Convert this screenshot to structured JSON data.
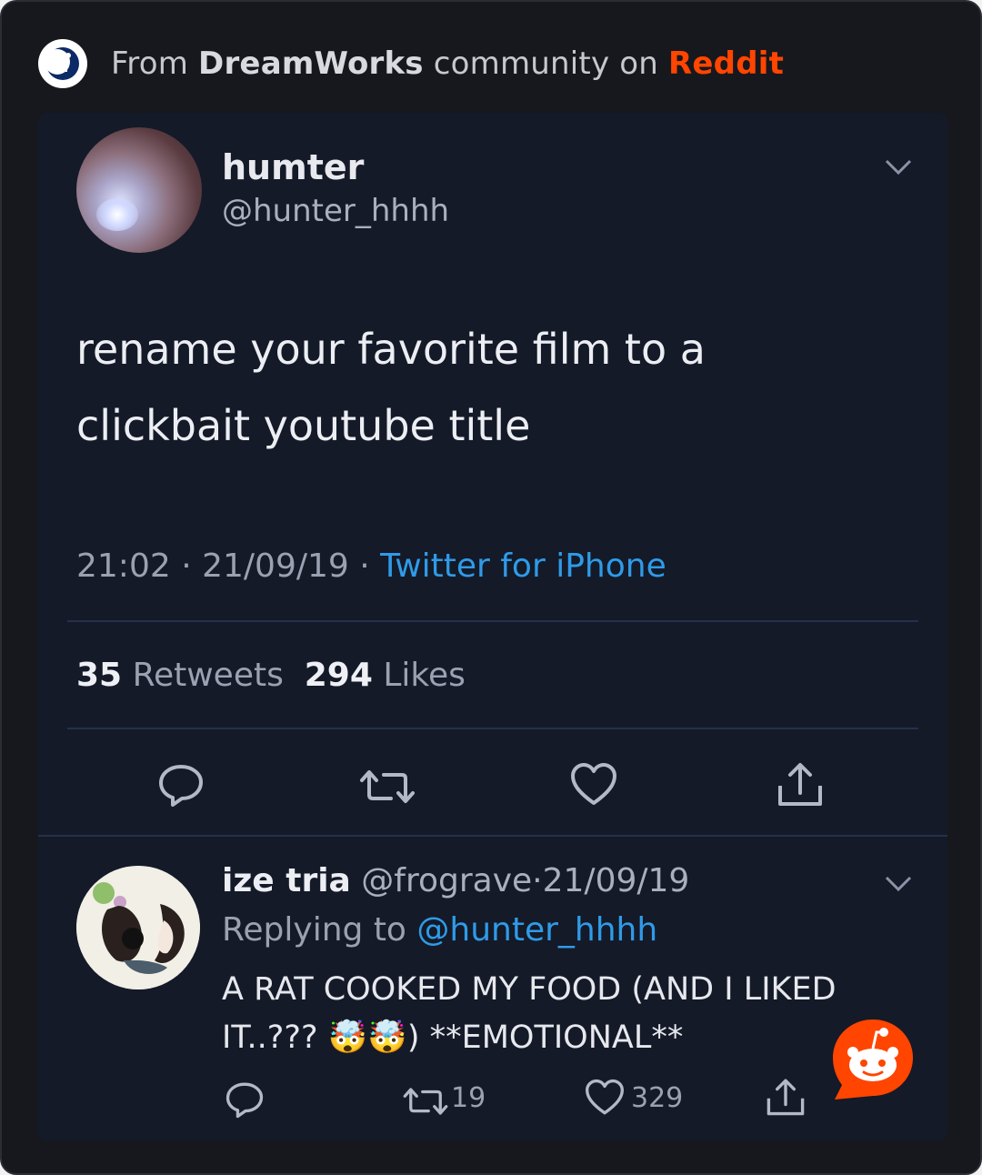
{
  "header": {
    "prefix": "From ",
    "community": "DreamWorks",
    "middle": " community on ",
    "platform": "Reddit",
    "platform_color": "#ff4500"
  },
  "tweet": {
    "display_name": "humter",
    "handle": "@hunter_hhhh",
    "text_line1": "rename your favorite film to a",
    "text_line2": "clickbait youtube title",
    "time": "21:02",
    "date": "21/09/19",
    "separator": "·",
    "source": "Twitter for iPhone",
    "retweet_count": "35",
    "retweet_label": "Retweets",
    "like_count": "294",
    "like_label": "Likes",
    "icons": [
      "reply-icon",
      "retweet-icon",
      "like-icon",
      "share-icon"
    ]
  },
  "reply": {
    "display_name": "ize tria",
    "handle": "@frograve",
    "date": "21/09/19",
    "separator": "·",
    "replying_prefix": "Replying to ",
    "replying_to": "@hunter_hhhh",
    "text_line1": "A RAT COOKED MY FOOD (AND I LIKED",
    "text_line2_a": "IT..??? ",
    "emoji": "🤯🤯",
    "text_line2_b": ") **EMOTIONAL**",
    "retweets": "19",
    "likes": "329"
  },
  "colors": {
    "background": "#16181d",
    "card": "#141a28",
    "link": "#2f9be8",
    "reddit": "#ff4500"
  }
}
